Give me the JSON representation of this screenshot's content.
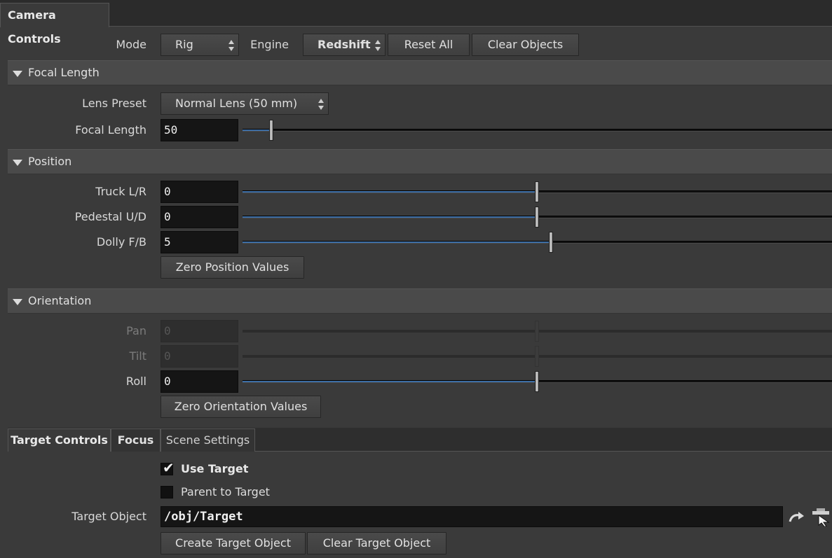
{
  "tabs": {
    "main": "Camera Controls"
  },
  "top": {
    "mode_label": "Mode",
    "mode_value": "Rig",
    "engine_label": "Engine",
    "engine_value": "Redshift",
    "reset_all": "Reset All",
    "clear_objects": "Clear Objects"
  },
  "focal": {
    "title": "Focal Length",
    "lens_label": "Lens Preset",
    "lens_value": "Normal Lens (50 mm)",
    "focal_label": "Focal Length",
    "focal_value": "50"
  },
  "position": {
    "title": "Position",
    "truck_label": "Truck L/R",
    "truck_value": "0",
    "pedestal_label": "Pedestal U/D",
    "pedestal_value": "0",
    "dolly_label": "Dolly F/B",
    "dolly_value": "5",
    "zero_button": "Zero Position Values"
  },
  "orientation": {
    "title": "Orientation",
    "pan_label": "Pan",
    "pan_value": "0",
    "tilt_label": "Tilt",
    "tilt_value": "0",
    "roll_label": "Roll",
    "roll_value": "0",
    "zero_button": "Zero Orientation Values"
  },
  "subtabs": [
    "Target Controls",
    "Focus",
    "Scene Settings"
  ],
  "target": {
    "use_target": "Use Target",
    "parent_to_target": "Parent to Target",
    "object_label": "Target Object",
    "object_value": "/obj/Target",
    "create_button": "Create Target Object",
    "clear_button": "Clear Target Object"
  },
  "icons": {
    "jump": "jump-arrow-icon",
    "chooser": "node-chooser-icon"
  },
  "colors": {
    "accent": "#3d6ea6",
    "background": "#3a3a3a",
    "field": "#151515"
  }
}
